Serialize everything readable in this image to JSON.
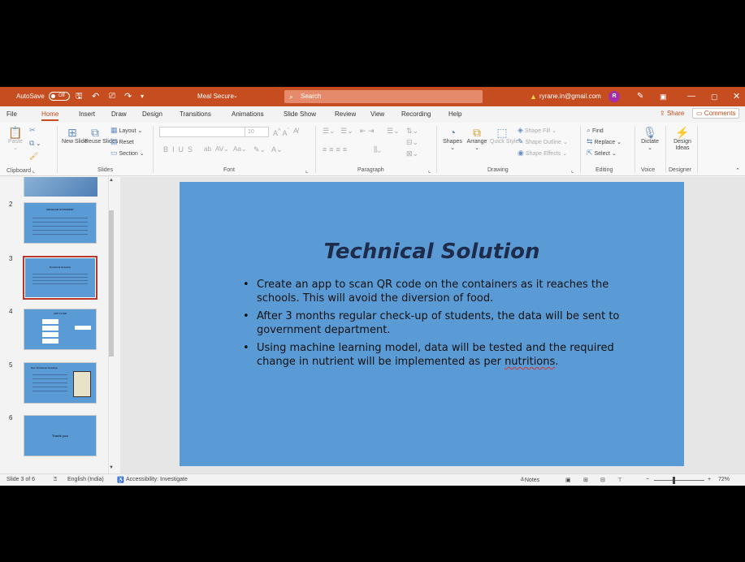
{
  "titlebar": {
    "autosave_label": "AutoSave",
    "autosave_state": "Off",
    "doc_title": "Meal Secure",
    "search_placeholder": "Search",
    "account": "ryrane.in@gmail.com",
    "avatar_initial": "R"
  },
  "tabs": [
    "File",
    "Home",
    "Insert",
    "Draw",
    "Design",
    "Transitions",
    "Animations",
    "Slide Show",
    "Review",
    "View",
    "Recording",
    "Help"
  ],
  "active_tab": "Home",
  "share_label": "Share",
  "comments_label": "Comments",
  "ribbon": {
    "clipboard": {
      "paste": "Paste",
      "label": "Clipboard"
    },
    "slides": {
      "new_slide": "New Slide",
      "reuse_slides": "Reuse Slides",
      "layout": "Layout",
      "reset": "Reset",
      "section": "Section",
      "label": "Slides"
    },
    "font": {
      "size": "10",
      "label": "Font"
    },
    "paragraph": {
      "label": "Paragraph"
    },
    "drawing": {
      "shapes": "Shapes",
      "arrange": "Arrange",
      "quick_styles": "Quick Styles",
      "shape_fill": "Shape Fill",
      "shape_outline": "Shape Outline",
      "shape_effects": "Shape Effects",
      "label": "Drawing"
    },
    "editing": {
      "find": "Find",
      "replace": "Replace",
      "select": "Select",
      "label": "Editing"
    },
    "voice": {
      "dictate": "Dictate",
      "label": "Voice"
    },
    "designer": {
      "design_ideas": "Design Ideas",
      "label": "Designer"
    }
  },
  "thumbnails": [
    {
      "number": "2",
      "title": "PROBLEM STATEMENT",
      "selected": false
    },
    {
      "number": "3",
      "title": "Technical Solution",
      "selected": true
    },
    {
      "number": "4",
      "title": "APP FLOW",
      "selected": false
    },
    {
      "number": "5",
      "title": "Non Technical Solution",
      "selected": false
    },
    {
      "number": "6",
      "title": "Thank you",
      "selected": false
    }
  ],
  "slide": {
    "title": "Technical Solution",
    "bullet_1": "Create an app to scan QR code on the containers as it reaches the schools. This will avoid the diversion of food.",
    "bullet_2": "After 3 months regular check-up of students, the data will be sent to government department.",
    "bullet_3_prefix": "Using machine learning model, data will be tested and the required change in nutrient will be implemented as per ",
    "bullet_3_misspelled": "nutritions",
    "bullet_3_suffix": "."
  },
  "statusbar": {
    "slide_counter": "Slide 3 of 6",
    "language": "English (India)",
    "accessibility": "Accessibility: Investigate",
    "notes": "Notes",
    "zoom": "72%"
  },
  "colors": {
    "accent": "#c64d1f",
    "slide_bg": "#5b9bd5",
    "title_text": "#1f2b4a"
  }
}
